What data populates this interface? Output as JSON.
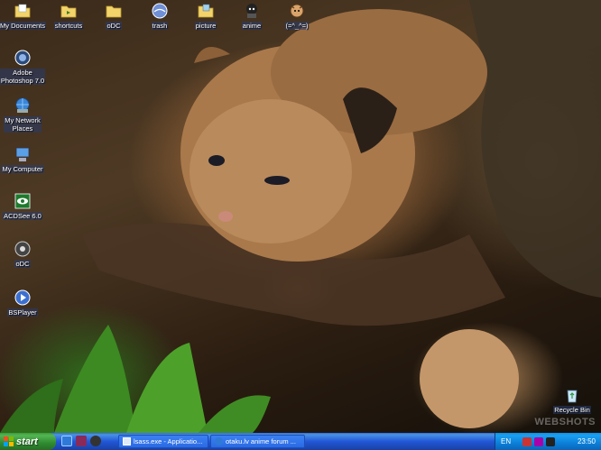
{
  "desktop": {
    "top_icons": [
      {
        "label": "My Documents",
        "icon": "folder-documents-icon"
      },
      {
        "label": "shortcuts",
        "icon": "folder-shortcuts-icon"
      },
      {
        "label": "oDC",
        "icon": "folder-icon"
      },
      {
        "label": "trash",
        "icon": "trash-orb-icon"
      },
      {
        "label": "picture",
        "icon": "folder-picture-icon"
      },
      {
        "label": "anime",
        "icon": "anime-icon"
      },
      {
        "label": "(=^_^=)",
        "icon": "cat-face-icon"
      }
    ],
    "left_icons": [
      {
        "label_line1": "Adobe",
        "label_line2": "Photoshop 7.0",
        "icon": "photoshop-icon"
      },
      {
        "label_line1": "My Network",
        "label_line2": "Places",
        "icon": "network-places-icon"
      },
      {
        "label_line1": "My Computer",
        "label_line2": "",
        "icon": "my-computer-icon"
      },
      {
        "label_line1": "ACDSee 6.0",
        "label_line2": "",
        "icon": "acdsee-icon"
      },
      {
        "label_line1": "oDC",
        "label_line2": "",
        "icon": "odc-icon"
      },
      {
        "label_line1": "BSPlayer",
        "label_line2": "",
        "icon": "bsplayer-icon"
      }
    ],
    "recycle_bin": {
      "label": "Recycle Bin",
      "icon": "recycle-bin-icon"
    },
    "watermark": "WEBSHOTS"
  },
  "taskbar": {
    "start_label": "start",
    "tasks": [
      {
        "label": "lsass.exe - Applicatio...",
        "icon": "window-icon"
      },
      {
        "label": "otaku.lv anime forum ...",
        "icon": "browser-icon"
      }
    ],
    "tray": {
      "language": "EN",
      "clock": "23:50"
    }
  },
  "colors": {
    "taskbar_blue": "#2157d7",
    "start_green": "#3c9a3c",
    "tray_blue": "#0f8ee3"
  }
}
